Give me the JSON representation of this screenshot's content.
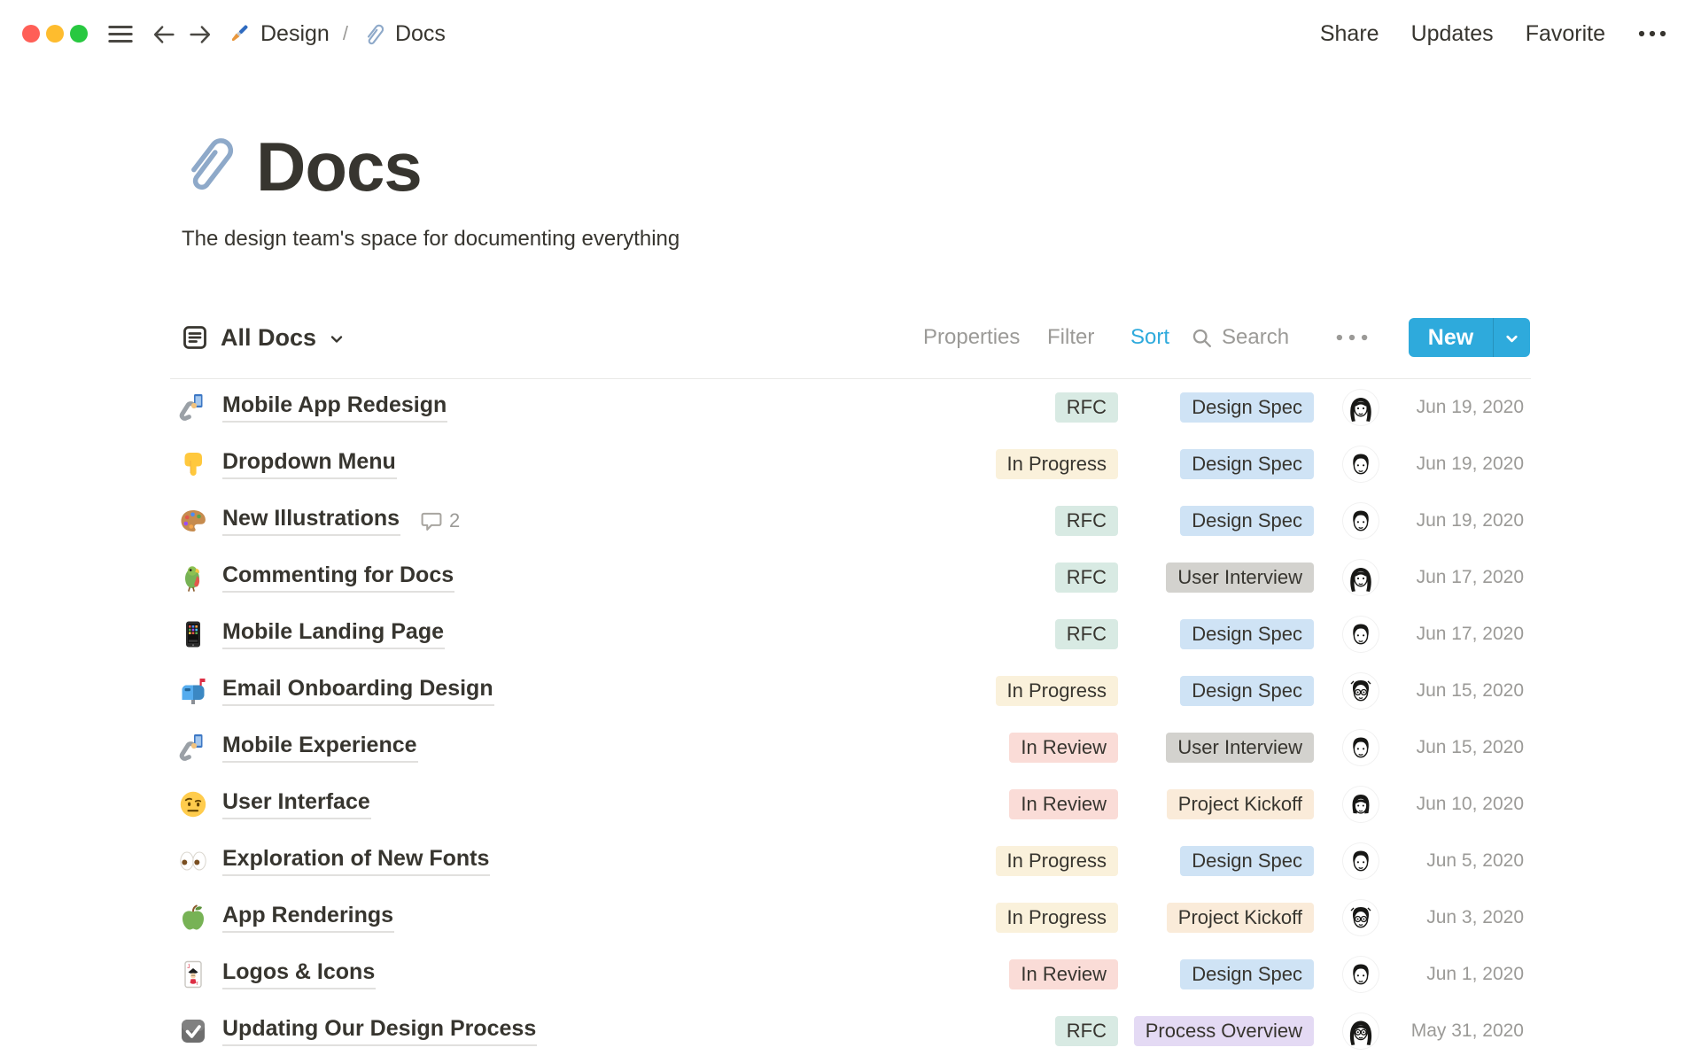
{
  "window": {
    "nav": {
      "menu_icon": "hamburger-icon",
      "back_icon": "arrow-left-icon",
      "forward_icon": "arrow-right-icon"
    },
    "breadcrumb": {
      "items": [
        {
          "icon": "paintbrush-icon",
          "label": "Design"
        },
        {
          "icon": "paperclip-icon",
          "label": "Docs"
        }
      ],
      "separator": "/"
    },
    "actions": {
      "share": "Share",
      "updates": "Updates",
      "favorite": "Favorite",
      "more_icon": "ellipsis-dark-icon"
    }
  },
  "page": {
    "icon": "paperclip-icon",
    "title": "Docs",
    "subtitle": "The design team's space for documenting everything"
  },
  "toolbar": {
    "view": {
      "icon": "list-view-icon",
      "label": "All Docs",
      "chevron_icon": "chevron-down-icon"
    },
    "properties_label": "Properties",
    "filter_label": "Filter",
    "sort_label": "Sort",
    "sort_active": true,
    "search": {
      "icon": "search-icon",
      "label": "Search"
    },
    "more_icon": "ellipsis-gray-icon",
    "new_button": {
      "label": "New",
      "chevron_icon": "chevron-down-white-icon",
      "color": "#2EAADC"
    }
  },
  "colors": {
    "accent_blue": "#2EAADC",
    "text": "#37352F",
    "muted_text": "#9B9A97",
    "divider": "#E9E9E7",
    "title_underline": "#E1E0DE",
    "traffic_red": "#FF5F57",
    "traffic_yellow": "#FEBC2E",
    "traffic_green": "#28C840"
  },
  "badge_colors": {
    "green": "#D8EAE3",
    "yellow": "#FAF1DB",
    "orange": "#FAEBD9",
    "blue": "#CFE3F5",
    "red": "#FADCD7",
    "gray": "#D3D2CE",
    "purple": "#E4DAF4"
  },
  "table": {
    "rows": [
      {
        "icon": "selfie-icon",
        "title": "Mobile App Redesign",
        "comments": null,
        "status": "RFC",
        "status_color": "green",
        "doc_type": "Design Spec",
        "type_color": "blue",
        "avatar": "woman-long-hair",
        "date": "Jun 19, 2020"
      },
      {
        "icon": "point-down-icon",
        "title": "Dropdown Menu",
        "comments": null,
        "status": "In Progress",
        "status_color": "yellow",
        "doc_type": "Design Spec",
        "type_color": "blue",
        "avatar": "man-short-hair",
        "date": "Jun 19, 2020"
      },
      {
        "icon": "palette-icon",
        "title": "New Illustrations",
        "comments": 2,
        "status": "RFC",
        "status_color": "green",
        "doc_type": "Design Spec",
        "type_color": "blue",
        "avatar": "man-short-hair",
        "date": "Jun 19, 2020"
      },
      {
        "icon": "parrot-icon",
        "title": "Commenting for Docs",
        "comments": null,
        "status": "RFC",
        "status_color": "green",
        "doc_type": "User Interview",
        "type_color": "gray",
        "avatar": "woman-long-hair",
        "date": "Jun 17, 2020"
      },
      {
        "icon": "mobile-phone-icon",
        "title": "Mobile Landing Page",
        "comments": null,
        "status": "RFC",
        "status_color": "green",
        "doc_type": "Design Spec",
        "type_color": "blue",
        "avatar": "man-short-hair",
        "date": "Jun 17, 2020"
      },
      {
        "icon": "mailbox-icon",
        "title": "Email Onboarding Design",
        "comments": null,
        "status": "In Progress",
        "status_color": "yellow",
        "doc_type": "Design Spec",
        "type_color": "blue",
        "avatar": "man-glasses",
        "date": "Jun 15, 2020"
      },
      {
        "icon": "selfie-icon",
        "title": "Mobile Experience",
        "comments": null,
        "status": "In Review",
        "status_color": "red",
        "doc_type": "User Interview",
        "type_color": "gray",
        "avatar": "man-short-hair",
        "date": "Jun 15, 2020"
      },
      {
        "icon": "raised-eyebrow-face-icon",
        "title": "User Interface",
        "comments": null,
        "status": "In Review",
        "status_color": "red",
        "doc_type": "Project Kickoff",
        "type_color": "orange",
        "avatar": "woman-bob",
        "date": "Jun 10, 2020"
      },
      {
        "icon": "eyes-icon",
        "title": "Exploration of New Fonts",
        "comments": null,
        "status": "In Progress",
        "status_color": "yellow",
        "doc_type": "Design Spec",
        "type_color": "blue",
        "avatar": "man-short-hair",
        "date": "Jun 5, 2020"
      },
      {
        "icon": "green-apple-icon",
        "title": "App Renderings",
        "comments": null,
        "status": "In Progress",
        "status_color": "yellow",
        "doc_type": "Project Kickoff",
        "type_color": "orange",
        "avatar": "man-glasses",
        "date": "Jun 3, 2020"
      },
      {
        "icon": "joker-card-icon",
        "title": "Logos & Icons",
        "comments": null,
        "status": "In Review",
        "status_color": "red",
        "doc_type": "Design Spec",
        "type_color": "blue",
        "avatar": "man-short-hair",
        "date": "Jun 1, 2020"
      },
      {
        "icon": "checkbox-icon",
        "title": "Updating Our Design Process",
        "comments": null,
        "status": "RFC",
        "status_color": "green",
        "doc_type": "Process Overview",
        "type_color": "purple",
        "avatar": "woman-glasses",
        "date": "May 31, 2020"
      }
    ]
  }
}
